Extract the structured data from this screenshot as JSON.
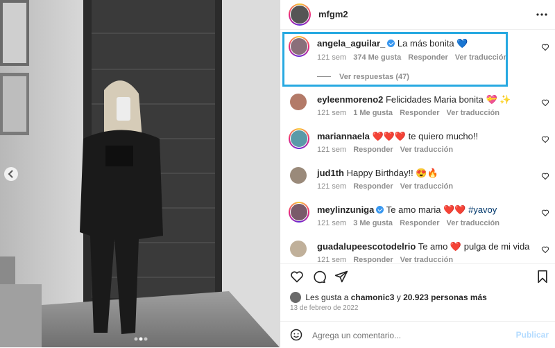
{
  "post": {
    "owner": "mfgm2",
    "more_icon": "more-horizontal-icon",
    "carousel_dots": 3,
    "active_dot": 1
  },
  "comments": [
    {
      "user": "angela_aguilar_",
      "verified": true,
      "text": " La más bonita 💙",
      "time": "121 sem",
      "likes": "374 Me gusta",
      "reply": "Responder",
      "translate": "Ver traducción",
      "view_replies": "Ver respuestas (47)"
    },
    {
      "user": "eyleenmoreno2",
      "verified": false,
      "text": " Felicidades Maria bonita 💝 ✨",
      "time": "121 sem",
      "likes": "1 Me gusta",
      "reply": "Responder",
      "translate": "Ver traducción"
    },
    {
      "user": "mariannaela",
      "verified": false,
      "text": " ❤️❤️❤️ te quiero mucho!!",
      "time": "121 sem",
      "likes": "",
      "reply": "Responder",
      "translate": "Ver traducción"
    },
    {
      "user": "jud1th",
      "verified": false,
      "text": " Happy Birthday!! 😍🔥",
      "time": "121 sem",
      "likes": "",
      "reply": "Responder",
      "translate": "Ver traducción"
    },
    {
      "user": "meylinzuniga",
      "verified": true,
      "text": " Te amo maria ❤️❤️ ",
      "hashtag": "#yavoy",
      "time": "121 sem",
      "likes": "3 Me gusta",
      "reply": "Responder",
      "translate": "Ver traducción"
    },
    {
      "user": "guadalupeescotodelrio",
      "verified": false,
      "text": " Te amo ❤️ pulga de mi vida",
      "time": "121 sem",
      "likes": "",
      "reply": "Responder",
      "translate": "Ver traducción"
    }
  ],
  "likes_line": {
    "prefix": "Les gusta a ",
    "user": "chamonic3",
    "middle": " y ",
    "count": "20.923 personas más"
  },
  "date": "13 de febrero de 2022",
  "composer": {
    "placeholder": "Agrega un comentario...",
    "publish": "Publicar"
  },
  "colors": {
    "accent": "#0095f6",
    "highlight": "#27a9e1",
    "muted": "#8e8e8e"
  }
}
